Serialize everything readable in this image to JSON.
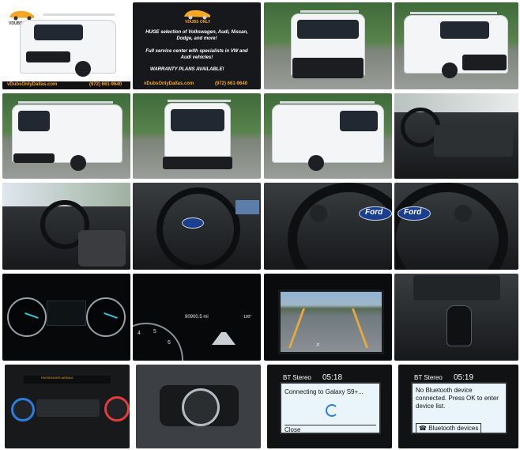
{
  "dealer": {
    "logo_text": "VDUBS ONLY",
    "website": "vDubsOnlyDallas.com",
    "phone": "(972) 661-9640",
    "headline": "HUGE selection of Volkswagen, Audi, Nissan, Dodge, and more!",
    "service": "Full service center with specialists in VW and Audi vehicles!",
    "warranty": "WARRANTY PLANS AVAILABLE!",
    "accent_color": "#f5a623"
  },
  "vehicle": {
    "badge": "Ford"
  },
  "odometer": {
    "reading": "90900.5 mi",
    "temp": "100°",
    "speed_ticks": [
      "4",
      "5",
      "6"
    ]
  },
  "climate": {
    "label": "PASSENGER AIRBAG"
  },
  "screens": [
    {
      "source": "BT Stereo",
      "time": "05:18",
      "message": "Connecting to Galaxy S9+...",
      "action": "Close"
    },
    {
      "source": "BT Stereo",
      "time": "05:19",
      "message": "No Bluetooth device connected. Press OK to enter device list.",
      "action": "Bluetooth devices"
    }
  ]
}
